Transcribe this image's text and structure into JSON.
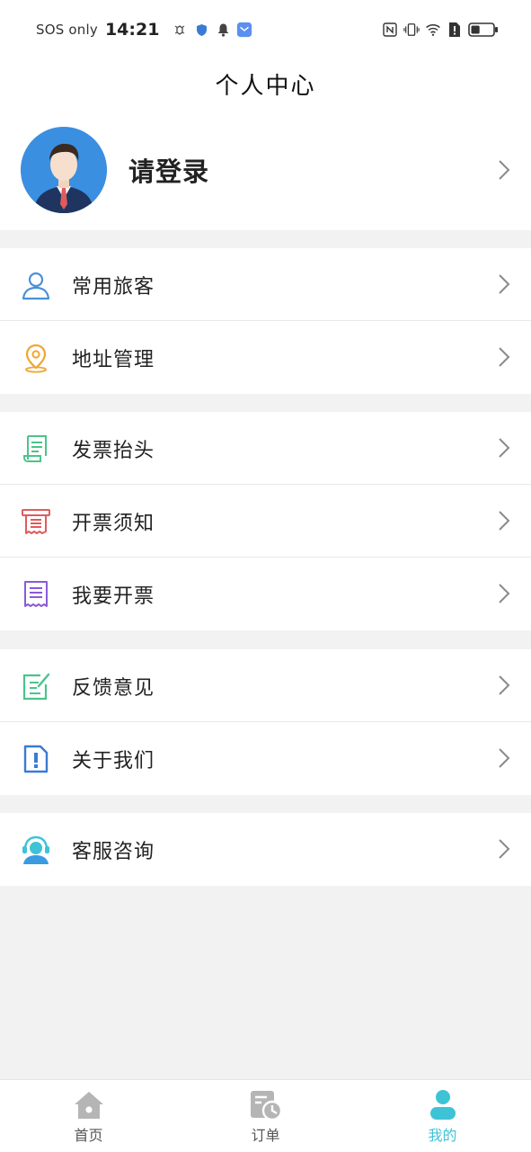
{
  "status_bar": {
    "carrier": "SOS only",
    "time": "14:21",
    "icons_left": [
      "bug-icon",
      "shield-icon",
      "bell-icon",
      "app-badge-icon"
    ],
    "icons_right": [
      "nfc-icon",
      "vibrate-icon",
      "wifi-icon",
      "sim-alert-icon",
      "battery-icon"
    ],
    "battery_level": 0.4
  },
  "header": {
    "title": "个人中心"
  },
  "profile": {
    "login_label": "请登录",
    "avatar": "business-man-avatar"
  },
  "groups": [
    {
      "items": [
        {
          "label": "常用旅客",
          "icon": "person-icon",
          "color": "#4a90d9"
        },
        {
          "label": "地址管理",
          "icon": "location-pin-icon",
          "color": "#f0a630"
        }
      ]
    },
    {
      "items": [
        {
          "label": "发票抬头",
          "icon": "invoice-scroll-icon",
          "color": "#4cc38a"
        },
        {
          "label": "开票须知",
          "icon": "receipt-icon",
          "color": "#e05b5b"
        },
        {
          "label": "我要开票",
          "icon": "document-icon",
          "color": "#8a5bd6"
        }
      ]
    },
    {
      "items": [
        {
          "label": "反馈意见",
          "icon": "feedback-edit-icon",
          "color": "#4cc38a"
        },
        {
          "label": "关于我们",
          "icon": "info-document-icon",
          "color": "#3a7bd5"
        }
      ]
    },
    {
      "items": [
        {
          "label": "客服咨询",
          "icon": "customer-service-icon",
          "color": "#3ec3d6"
        }
      ]
    }
  ],
  "bottom_nav": {
    "items": [
      {
        "label": "首页",
        "icon": "home-icon",
        "active": false
      },
      {
        "label": "订单",
        "icon": "order-clock-icon",
        "active": false
      },
      {
        "label": "我的",
        "icon": "user-icon",
        "active": true
      }
    ],
    "active_color": "#3ec3d6",
    "inactive_color": "#b5b5b5"
  }
}
